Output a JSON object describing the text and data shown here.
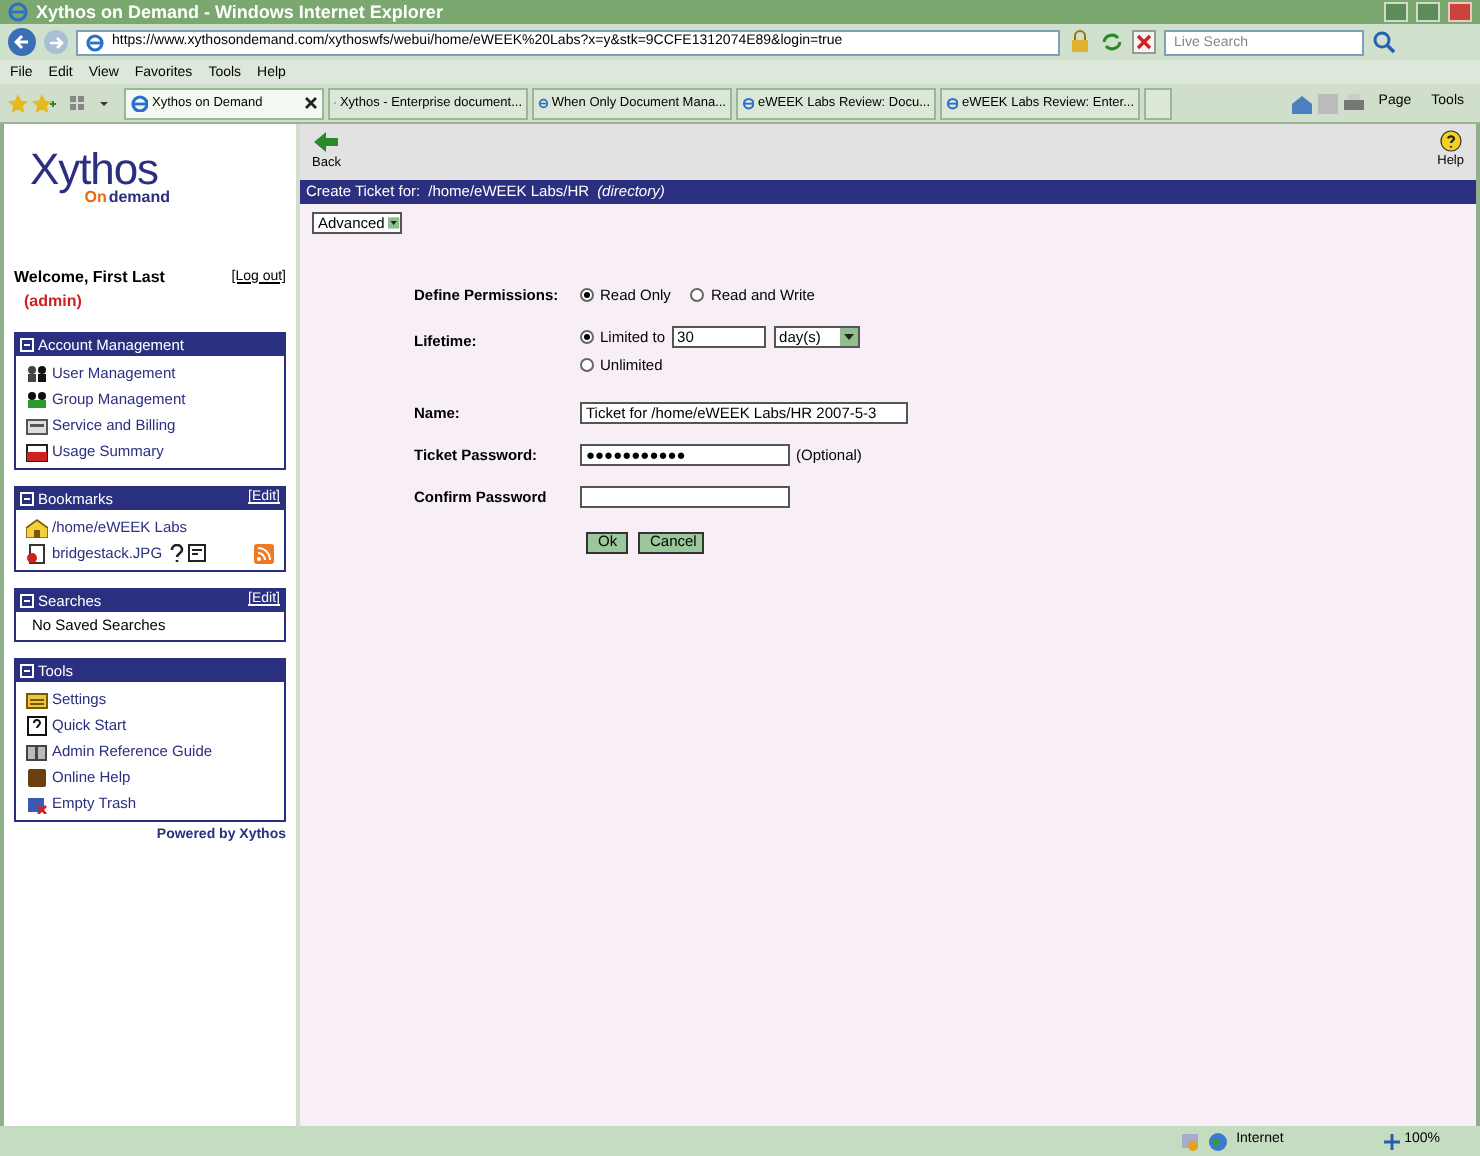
{
  "window": {
    "title": "Xythos on Demand - Windows Internet Explorer"
  },
  "address_bar": {
    "url": "https://www.xythosondemand.com/xythoswfs/webui/home/eWEEK%20Labs?x=y&stk=9CCFE1312074E89&login=true",
    "search_placeholder": "Live Search"
  },
  "menu": [
    "File",
    "Edit",
    "View",
    "Favorites",
    "Tools",
    "Help"
  ],
  "tabs": [
    {
      "label": "Xythos on Demand",
      "selected": true
    },
    {
      "label": "Xythos - Enterprise document...",
      "selected": false
    },
    {
      "label": "When Only Document Mana...",
      "selected": false
    },
    {
      "label": "eWEEK Labs Review: Docu...",
      "selected": false
    },
    {
      "label": "eWEEK Labs Review: Enter...",
      "selected": false
    }
  ],
  "command_bar": [
    "Page",
    "Tools"
  ],
  "sidebar": {
    "logo": {
      "name": "Xythos",
      "tagline_prefix": "On",
      "tagline": "demand"
    },
    "welcome": "Welcome, First Last",
    "logout": "[Log out]",
    "role": "(admin)",
    "panels": [
      {
        "title": "Account Management",
        "items": [
          {
            "label": "User Management",
            "kind": "users"
          },
          {
            "label": "Group Management",
            "kind": "group"
          },
          {
            "label": "Service and Billing",
            "kind": "billing"
          },
          {
            "label": "Usage Summary",
            "kind": "folder"
          }
        ]
      },
      {
        "title": "Bookmarks",
        "edit": "[Edit]",
        "items": [
          {
            "label": "/home/eWEEK Labs",
            "kind": "home"
          },
          {
            "label": "bridgestack.JPG",
            "kind": "file"
          }
        ]
      },
      {
        "title": "Searches",
        "edit": "[Edit]",
        "items": [
          {
            "label": "No Saved Searches",
            "kind": "plain"
          }
        ]
      },
      {
        "title": "Tools",
        "items": [
          {
            "label": "Settings",
            "kind": "settings"
          },
          {
            "label": "Quick Start",
            "kind": "quick"
          },
          {
            "label": "Admin Reference Guide",
            "kind": "guide"
          },
          {
            "label": "Online Help",
            "kind": "help"
          },
          {
            "label": "Empty Trash",
            "kind": "trash"
          }
        ]
      }
    ],
    "powered_by": "Powered by Xythos"
  },
  "toolbar": {
    "back": "Back",
    "help": "Help"
  },
  "header": {
    "prefix": "Create Ticket for:",
    "path": "/home/eWEEK Labs/HR",
    "note": "(directory)"
  },
  "mode_select": "Advanced",
  "form": {
    "permissions": {
      "label": "Define Permissions:",
      "options": [
        {
          "label": "Read Only",
          "selected": true
        },
        {
          "label": "Read and Write",
          "selected": false
        }
      ]
    },
    "lifetime": {
      "label": "Lifetime:",
      "options": [
        {
          "label": "Limited to",
          "selected": true
        },
        {
          "label": "Unlimited",
          "selected": false
        }
      ],
      "amount": "30",
      "unit": "day(s)"
    },
    "name": {
      "label": "Name:",
      "value": "Ticket for /home/eWEEK Labs/HR 2007-5-3"
    },
    "password": {
      "label": "Ticket Password:",
      "value": "●●●●●●●●●●●",
      "hint": "(Optional)"
    },
    "confirm": {
      "label": "Confirm Password"
    },
    "buttons": [
      "Ok",
      "Cancel"
    ]
  },
  "status_bar": {
    "zone": "Internet",
    "zoom": "100%"
  }
}
